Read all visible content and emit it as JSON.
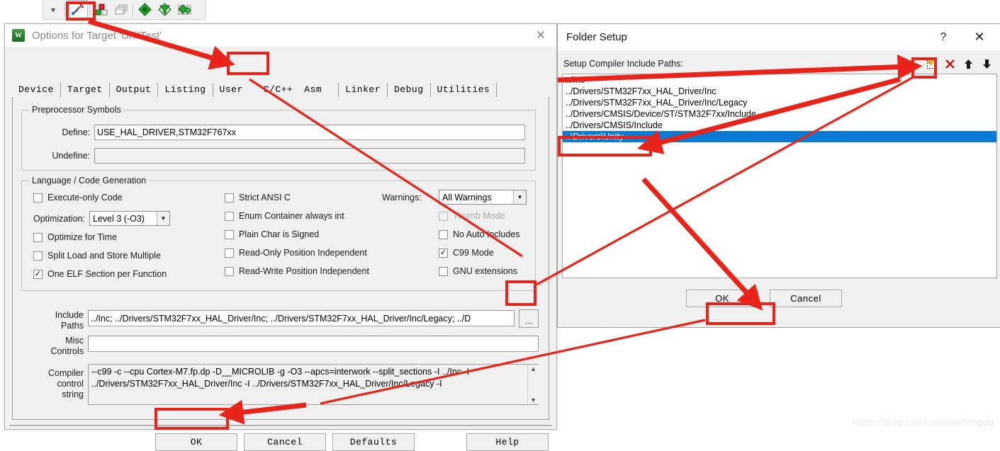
{
  "toolbar": {
    "dropdown_icon": "chevron-down-icon",
    "buttons": [
      {
        "name": "configure-target-options-wizard-icon",
        "label": "Options for Target"
      },
      {
        "name": "manage-project-items-icon",
        "label": "Manage Project Items"
      },
      {
        "name": "multi-project-icon",
        "label": "Multi-Project"
      },
      {
        "name": "pack-installer-green-icon",
        "label": "Pack Installer"
      },
      {
        "name": "manage-run-time-environment-icon",
        "label": "Manage Run-Time Environment"
      },
      {
        "name": "pack-green-folder-icon",
        "label": "Packs"
      }
    ]
  },
  "options_dialog": {
    "title": "Options for Target 'UnitTest'",
    "icon_name": "keil-uvision-icon",
    "close_label": "✕",
    "tabs": [
      {
        "label": "Device",
        "selected": false
      },
      {
        "label": "Target",
        "selected": false
      },
      {
        "label": "Output",
        "selected": false
      },
      {
        "label": "Listing",
        "selected": false
      },
      {
        "label": "User",
        "selected": false
      },
      {
        "label": "C/C++",
        "selected": true
      },
      {
        "label": "Asm",
        "selected": false
      },
      {
        "label": "Linker",
        "selected": false
      },
      {
        "label": "Debug",
        "selected": false
      },
      {
        "label": "Utilities",
        "selected": false
      }
    ],
    "preprocessor": {
      "group_label": "Preprocessor Symbols",
      "define_label": "Define:",
      "define_value": "USE_HAL_DRIVER,STM32F767xx",
      "undefine_label": "Undefine:",
      "undefine_value": ""
    },
    "language": {
      "group_label": "Language / Code Generation",
      "left_checks": [
        {
          "label": "Execute-only Code",
          "checked": false,
          "disabled": false
        },
        {
          "label": "Optimize for Time",
          "checked": false,
          "disabled": false
        },
        {
          "label": "Split Load and Store Multiple",
          "checked": false,
          "disabled": false
        },
        {
          "label": "One ELF Section per Function",
          "checked": true,
          "disabled": false
        }
      ],
      "optimization_label": "Optimization:",
      "optimization_value": "Level 3 (-O3)",
      "middle_checks": [
        {
          "label": "Strict ANSI C",
          "checked": false,
          "disabled": false
        },
        {
          "label": "Enum Container always int",
          "checked": false,
          "disabled": false
        },
        {
          "label": "Plain Char is Signed",
          "checked": false,
          "disabled": false
        },
        {
          "label": "Read-Only Position Independent",
          "checked": false,
          "disabled": false
        },
        {
          "label": "Read-Write Position Independent",
          "checked": false,
          "disabled": false
        }
      ],
      "warnings_label": "Warnings:",
      "warnings_value": "All Warnings",
      "right_checks": [
        {
          "label": "Thumb Mode",
          "checked": false,
          "disabled": true
        },
        {
          "label": "No Auto Includes",
          "checked": false,
          "disabled": false
        },
        {
          "label": "C99 Mode",
          "checked": true,
          "disabled": false
        },
        {
          "label": "GNU extensions",
          "checked": false,
          "disabled": false
        }
      ]
    },
    "include_paths": {
      "label_line1": "Include",
      "label_line2": "Paths",
      "value": "../Inc; ../Drivers/STM32F7xx_HAL_Driver/Inc; ../Drivers/STM32F7xx_HAL_Driver/Inc/Legacy; ../D",
      "browse_button": "..."
    },
    "misc_controls": {
      "label_line1": "Misc",
      "label_line2": "Controls",
      "value": ""
    },
    "compiler_control": {
      "label_line1": "Compiler",
      "label_line2": "control",
      "label_line3": "string",
      "line1": "--c99 -c --cpu Cortex-M7.fp.dp -D__MICROLIB -g -O3 --apcs=interwork --split_sections -I ../Inc -I",
      "line2": "../Drivers/STM32F7xx_HAL_Driver/Inc -I ../Drivers/STM32F7xx_HAL_Driver/Inc/Legacy -I",
      "scroll_up": "▲",
      "scroll_down": "▼"
    },
    "buttons": [
      {
        "label": "OK",
        "highlighted": true
      },
      {
        "label": "Cancel",
        "highlighted": false
      },
      {
        "label": "Defaults",
        "highlighted": false
      },
      {
        "label": "Help",
        "highlighted": false
      }
    ]
  },
  "folder_dialog": {
    "title": "Folder Setup",
    "help_label": "?",
    "close_label": "✕",
    "list_label": "Setup Compiler Include Paths:",
    "toolbar_buttons": [
      {
        "name": "new-path-icon",
        "label": "New (Insert)"
      },
      {
        "name": "delete-path-icon",
        "label": "Delete"
      },
      {
        "name": "move-up-icon",
        "label": "Move Up"
      },
      {
        "name": "move-down-icon",
        "label": "Move Down"
      }
    ],
    "items": [
      {
        "text": "../Inc",
        "selected": false
      },
      {
        "text": "../Drivers/STM32F7xx_HAL_Driver/Inc",
        "selected": false
      },
      {
        "text": "../Drivers/STM32F7xx_HAL_Driver/Inc/Legacy",
        "selected": false
      },
      {
        "text": "../Drivers/CMSIS/Device/ST/STM32F7xx/Include",
        "selected": false
      },
      {
        "text": "../Drivers/CMSIS/Include",
        "selected": false
      },
      {
        "text": "..\\Drivers\\Unity",
        "selected": true
      }
    ],
    "buttons": [
      {
        "label": "OK",
        "highlighted": true
      },
      {
        "label": "Cancel",
        "highlighted": false
      }
    ]
  },
  "annotations": {
    "highlight_color": "#e8231a",
    "watermark": "https://blog.csdn.net/weifengdq"
  }
}
